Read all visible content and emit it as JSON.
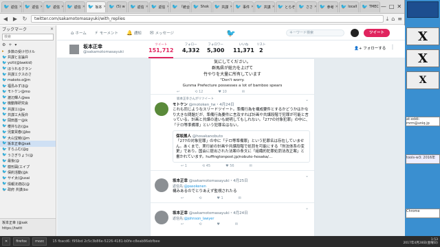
{
  "browser": {
    "tabs": [
      {
        "label": "返信"
      },
      {
        "label": "返信"
      },
      {
        "label": "返信"
      },
      {
        "label": "返信"
      },
      {
        "label": "坂本",
        "active": true
      },
      {
        "label": "(5) w"
      },
      {
        "label": "返信"
      },
      {
        "label": "返信"
      },
      {
        "label": "「統合"
      },
      {
        "label": "Shok"
      },
      {
        "label": "共謀"
      },
      {
        "label": "事件"
      },
      {
        "label": "共謀"
      },
      {
        "label": "とらぞ"
      },
      {
        "label": "ささ"
      },
      {
        "label": "参考"
      },
      {
        "label": "locall"
      },
      {
        "label": "TMEC"
      }
    ],
    "url": "twitter.com/sakamotomasayuki/with_replies",
    "window_controls": [
      "—",
      "□",
      "✕"
    ]
  },
  "sidebar": {
    "title": "ブックマーク",
    "search_placeholder": "検索",
    "tools": [
      "⚙",
      "+",
      "▾"
    ],
    "items": [
      {
        "label": "多数の受け付けル",
        "type": "folder"
      },
      {
        "label": "共謀と言論弁",
        "type": "tw"
      },
      {
        "label": "yoXi(@lawkid)",
        "type": "tw"
      },
      {
        "label": "ほうれるクラン",
        "type": "tw"
      },
      {
        "label": "共謀エクスのさ",
        "type": "tw"
      },
      {
        "label": "makoto.o@m",
        "type": "tw"
      },
      {
        "label": "福島みずほ@",
        "type": "tw"
      },
      {
        "label": "モトケン@mo",
        "type": "tw"
      },
      {
        "label": "渡辺輝人@wa",
        "type": "tw"
      },
      {
        "label": "機動隊研究会",
        "type": "tw"
      },
      {
        "label": "共謀エ(@a",
        "type": "tw"
      },
      {
        "label": "共謀エ大阪弁",
        "type": "tw"
      },
      {
        "label": "岡田基一@ik",
        "type": "tw"
      },
      {
        "label": "櫻井なお(@a",
        "type": "tw"
      },
      {
        "label": "児童買春(@bo",
        "type": "tw"
      },
      {
        "label": "大山宝暁(@m",
        "type": "tw"
      },
      {
        "label": "坂本正幸@sak",
        "type": "tw",
        "selected": true
      },
      {
        "label": "すらふむ(@g",
        "type": "tw"
      },
      {
        "label": "うさぎりょう(@",
        "type": "tw"
      },
      {
        "label": "最後(@",
        "type": "tw"
      },
      {
        "label": "樹形図(エイプ",
        "type": "tw"
      },
      {
        "label": "保釣活動(@k",
        "type": "tw"
      },
      {
        "label": "サイ太(@usai",
        "type": "tw"
      },
      {
        "label": "情報法適応(@",
        "type": "tw"
      },
      {
        "label": "政府 共謀(bo",
        "type": "tw"
      }
    ],
    "footer": [
      "坂本正幸 (@sak",
      "https://twitt"
    ]
  },
  "twitter_nav": {
    "items": [
      {
        "label": "ホーム",
        "icon": "home-icon",
        "glyph": "⌂"
      },
      {
        "label": "モーメント",
        "icon": "lightning-icon",
        "glyph": "⚡"
      },
      {
        "label": "通知",
        "icon": "bell-icon",
        "glyph": "🔔"
      },
      {
        "label": "メッセージ",
        "icon": "envelope-icon",
        "glyph": "✉"
      }
    ],
    "search_placeholder": "キーワード検索",
    "tweet_button": "ツイート"
  },
  "profile": {
    "name": "坂本正幸",
    "handle": "@sakamotomasayuki",
    "stats": [
      {
        "label": "ツイート",
        "value": "151,712",
        "active": true
      },
      {
        "label": "フォロー",
        "value": "4,332"
      },
      {
        "label": "フォロワー",
        "value": "5,300"
      },
      {
        "label": "いいね",
        "value": "11,371"
      },
      {
        "label": "リスト",
        "value": "2"
      }
    ],
    "follow_label": "フォローする",
    "more_glyph": "⋮"
  },
  "timeline": {
    "quote_image": {
      "jp_lines": [
        "気にしてください。",
        "群馬県が総力を上げて",
        "竹やりを大量に所有しています"
      ],
      "en_lines": [
        "\"Don't worry.",
        "Gunma Prefecture possesses a lot of bamboo spears"
      ]
    },
    "top_actions": {
      "reply": "",
      "retweet": "12",
      "like": "10"
    },
    "tweets": [
      {
        "rt_note": "坂本正幸さんがリツイート",
        "name": "モトケン",
        "handle": "@motoken_tw",
        "date": "・4月24日",
        "body": "これも同じようなスリードツイート。準備行為を構成要件とするかどうかはかなり大きな問題だが、準備行為要件に言及すれば計画や共謀段階で犯罪が可能と言っている。計画と共謀の違いも説明してもしれない。「277の対象犯罪」の中に、「テロ等準備罪」という犯罪名はない。",
        "quote": {
          "name": "保坂展人",
          "handle": "@hosakanobuto",
          "body": "「277の対象犯罪」の中に「テロ等準備罪」という犯罪名は存在していません。あくまで、実行前の計画や共謀段階で処罰を可能にする「刑法体系の変更」であり。国会に提出された法案の条文に「組織的犯罪処罰法改正案」と書かれています。huffingtonpost.jp/nobuto-hosaka/..."
        },
        "actions": {
          "reply": "1",
          "retweet": "45",
          "like": "56"
        },
        "avatar_color": "#5a8a3a"
      },
      {
        "rt_note": "",
        "name": "坂本正幸",
        "handle": "@sakamotomasayuki",
        "date": "・4月25日",
        "reply_to": "@pasokenen",
        "body": "構みあるのでとりあえず監視されたる",
        "actions": {
          "reply": "",
          "retweet": "",
          "like": "1"
        },
        "avatar_color": "#8b8f93"
      },
      {
        "rt_note": "",
        "name": "坂本正幸",
        "handle": "@sakamotomasayuki",
        "date": "・4月24日",
        "reply_to": "@johnson_lawyer",
        "body": "",
        "actions": {
          "reply": "",
          "retweet": "",
          "like": ""
        },
        "avatar_color": "#8b8f93"
      }
    ],
    "reply_prefix": "返信先:"
  },
  "taskbar": {
    "start": "✕",
    "items": [
      "firefox",
      "mozc"
    ],
    "status": "15 fbacd6: f95lbd 2c5c3b86e-5226-4181-b0fe-c8eab86ebfbee",
    "clock_lines": [
      "1:53",
      "2017年4月28日(金曜日)"
    ]
  },
  "desktop": {
    "side_texts": [
      "Chrome",
      "@sakamoto",
      "tools-w3: 2016年",
      "at-eddi-mrm@uniq.jp"
    ],
    "x_label": "X"
  },
  "colors": {
    "twitter_blue": "#1da1f2",
    "tweet_pink": "#e0245e"
  }
}
